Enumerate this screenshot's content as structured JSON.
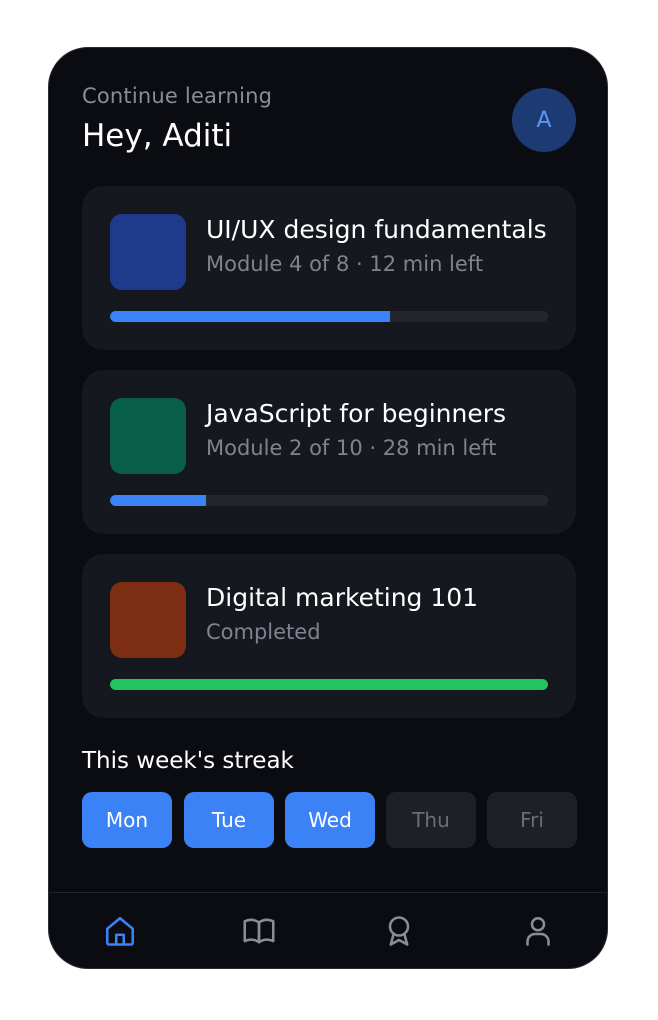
{
  "header": {
    "subtitle": "Continue learning",
    "greeting": "Hey, Aditi",
    "avatar_initial": "A"
  },
  "courses": [
    {
      "title": "UI/UX design fundamentals",
      "meta": "Module 4 of 8 · 12 min left",
      "progress": 0.64,
      "thumb_color": "#1e3a8a",
      "bar_color": "#3b82f6"
    },
    {
      "title": "JavaScript for beginners",
      "meta": "Module 2 of 10 · 28 min left",
      "progress": 0.22,
      "thumb_color": "#065f46",
      "bar_color": "#3b82f6"
    },
    {
      "title": "Digital marketing 101",
      "meta": "Completed",
      "progress": 1.0,
      "thumb_color": "#7c2d12",
      "bar_color": "#22c55e"
    }
  ],
  "streak": {
    "title": "This week's streak",
    "days": [
      {
        "label": "Mon",
        "done": true
      },
      {
        "label": "Tue",
        "done": true
      },
      {
        "label": "Wed",
        "done": true
      },
      {
        "label": "Thu",
        "done": false
      },
      {
        "label": "Fri",
        "done": false
      }
    ]
  },
  "nav": [
    {
      "icon": "home-icon",
      "active": true
    },
    {
      "icon": "book-icon",
      "active": false
    },
    {
      "icon": "award-icon",
      "active": false
    },
    {
      "icon": "user-icon",
      "active": false
    }
  ],
  "colors": {
    "accent": "#3b82f6",
    "success": "#22c55e",
    "background": "#0b0c11",
    "card": "#16181f"
  }
}
